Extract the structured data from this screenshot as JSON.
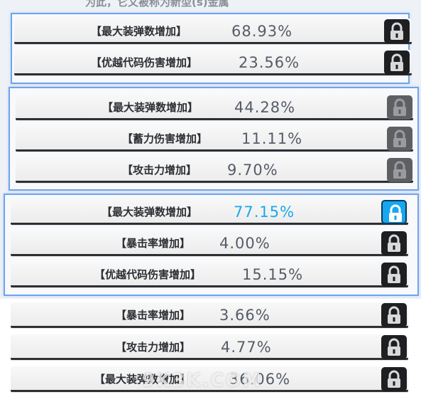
{
  "header_cut_text": "为此，它又被称为新型(s)金属",
  "groups": [
    {
      "rows": [
        {
          "label": "【最大装弹数增加】",
          "value": "68.93%",
          "lock": "locked"
        },
        {
          "label": "【优越代码伤害增加】",
          "value": "23.56%",
          "lock": "locked"
        }
      ]
    },
    {
      "rows": [
        {
          "label": "【最大装弹数增加】",
          "value": "44.28%",
          "lock": "dim"
        },
        {
          "label": "【蓄力伤害增加】",
          "value": "11.11%",
          "lock": "dim"
        },
        {
          "label": "【攻击力增加】",
          "value": "9.70%",
          "lock": "dim"
        }
      ]
    },
    {
      "rows": [
        {
          "label": "【最大装弹数增加】",
          "value": "77.15%",
          "lock": "unlocked",
          "highlight": true
        },
        {
          "label": "【暴击率增加】",
          "value": "4.00%",
          "lock": "locked"
        },
        {
          "label": "【优越代码伤害增加】",
          "value": "15.15%",
          "lock": "locked"
        }
      ]
    },
    {
      "rows": [
        {
          "label": "【暴击率增加】",
          "value": "3.66%",
          "lock": "locked"
        },
        {
          "label": "【攻击力增加】",
          "value": "4.77%",
          "lock": "locked"
        },
        {
          "label": "【最大装弹数增加】",
          "value": "36.06%",
          "lock": "locked"
        }
      ]
    }
  ],
  "icons": {
    "locked": "lock-icon",
    "unlocked": "unlock-icon"
  },
  "colors": {
    "highlight": "#1aa9ea",
    "frame": "#6fa2ef",
    "lock_bg": "#1e1f22"
  },
  "watermark": "9K3K.COM"
}
